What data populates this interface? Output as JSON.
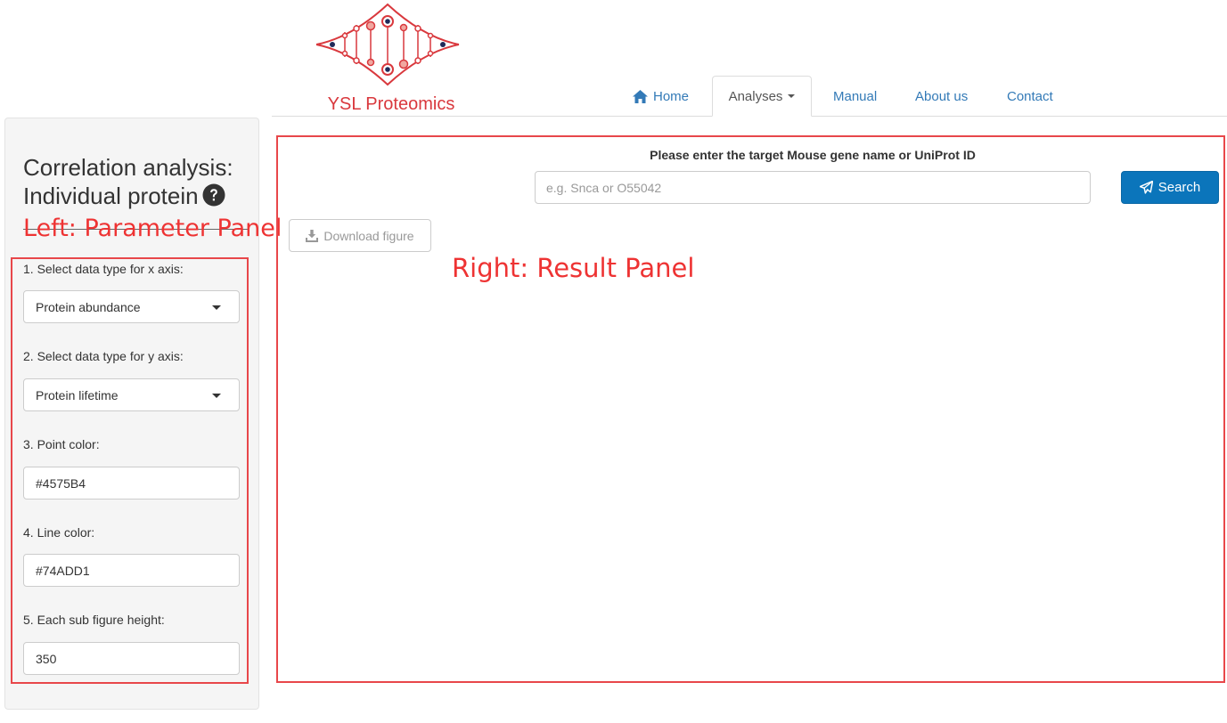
{
  "brand": {
    "name": "YSL Proteomics",
    "logo_icon": "dna-helix-logo"
  },
  "nav": {
    "items": [
      {
        "label": "Home",
        "icon": "home-icon"
      },
      {
        "label": "Analyses",
        "icon": "caret-down-icon",
        "active": true
      },
      {
        "label": "Manual"
      },
      {
        "label": "About us"
      },
      {
        "label": "Contact"
      }
    ]
  },
  "sidebar": {
    "title_line1": "Correlation analysis:",
    "title_line2": "Individual protein",
    "help_icon": "question-circle-icon",
    "fields": [
      {
        "label": "1. Select data type for x axis:",
        "value": "Protein abundance",
        "type": "select"
      },
      {
        "label": "2. Select data type for y axis:",
        "value": "Protein lifetime",
        "type": "select"
      },
      {
        "label": "3. Point color:",
        "value": "#4575B4",
        "type": "text"
      },
      {
        "label": "4. Line color:",
        "value": "#74ADD1",
        "type": "text"
      },
      {
        "label": "5. Each sub figure height:",
        "value": "350",
        "type": "text"
      }
    ]
  },
  "main": {
    "search_label": "Please enter the target Mouse gene name or UniProt ID",
    "search_placeholder": "e.g. Snca or O55042",
    "search_button": "Search",
    "download_button": "Download figure"
  },
  "annotations": {
    "left": "Left: Parameter Panel",
    "right": "Right: Result Panel"
  },
  "colors": {
    "brand_red": "#d9383d",
    "link_blue": "#337ab7",
    "search_button": "#0b75bb",
    "annotation_red": "#ee3333"
  }
}
